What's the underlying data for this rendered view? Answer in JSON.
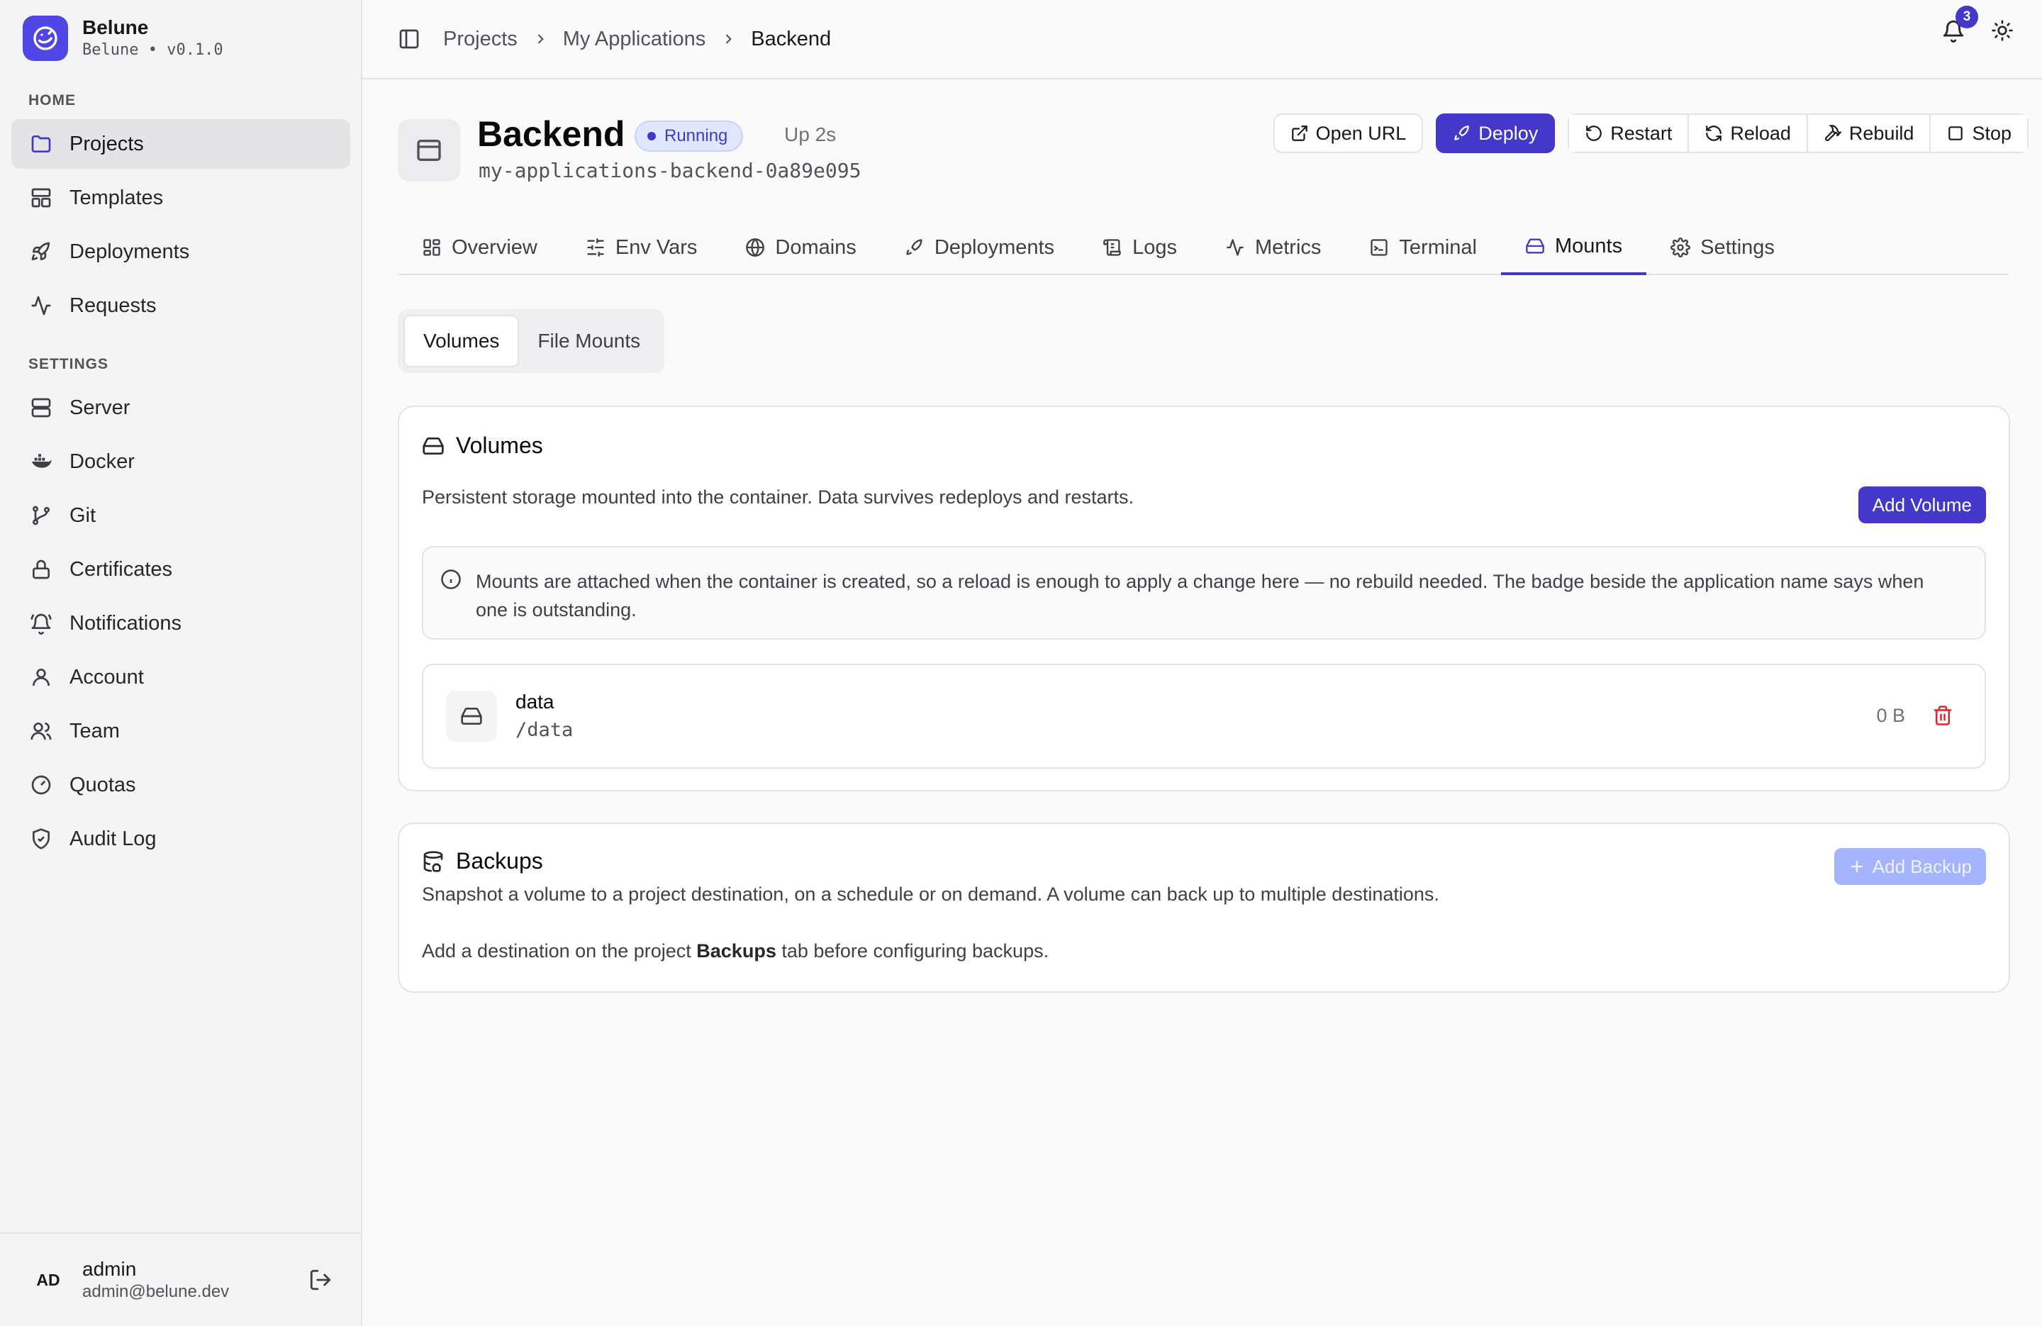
{
  "app": {
    "name": "Belune",
    "version": "Belune • v0.1.0"
  },
  "sidebar": {
    "home_label": "HOME",
    "home_items": [
      {
        "label": "Projects",
        "icon": "folder-icon",
        "active": true
      },
      {
        "label": "Templates",
        "icon": "layout-icon"
      },
      {
        "label": "Deployments",
        "icon": "rocket-icon"
      },
      {
        "label": "Requests",
        "icon": "activity-icon"
      }
    ],
    "settings_label": "SETTINGS",
    "settings_items": [
      {
        "label": "Server",
        "icon": "server-icon"
      },
      {
        "label": "Docker",
        "icon": "docker-icon"
      },
      {
        "label": "Git",
        "icon": "git-branch-icon"
      },
      {
        "label": "Certificates",
        "icon": "lock-icon"
      },
      {
        "label": "Notifications",
        "icon": "bell-ring-icon"
      },
      {
        "label": "Account",
        "icon": "user-icon"
      },
      {
        "label": "Team",
        "icon": "users-icon"
      },
      {
        "label": "Quotas",
        "icon": "gauge-icon"
      },
      {
        "label": "Audit Log",
        "icon": "shield-check-icon"
      }
    ],
    "user": {
      "initials": "AD",
      "name": "admin",
      "email": "admin@belune.dev"
    }
  },
  "breadcrumb": [
    "Projects",
    "My Applications",
    "Backend"
  ],
  "notifications_count": "3",
  "application": {
    "name": "Backend",
    "status": "Running",
    "uptime": "Up 2s",
    "slug": "my-applications-backend-0a89e095"
  },
  "actions": {
    "open_url": "Open URL",
    "deploy": "Deploy",
    "restart": "Restart",
    "reload": "Reload",
    "rebuild": "Rebuild",
    "stop": "Stop"
  },
  "tabs": [
    {
      "label": "Overview",
      "icon": "grid-icon"
    },
    {
      "label": "Env Vars",
      "icon": "sliders-icon"
    },
    {
      "label": "Domains",
      "icon": "globe-icon"
    },
    {
      "label": "Deployments",
      "icon": "rocket-icon"
    },
    {
      "label": "Logs",
      "icon": "scroll-icon"
    },
    {
      "label": "Metrics",
      "icon": "activity-icon"
    },
    {
      "label": "Terminal",
      "icon": "terminal-icon"
    },
    {
      "label": "Mounts",
      "icon": "hard-drive-icon",
      "active": true
    },
    {
      "label": "Settings",
      "icon": "gear-icon"
    }
  ],
  "subtabs": [
    {
      "label": "Volumes",
      "active": true
    },
    {
      "label": "File Mounts"
    }
  ],
  "volumes_card": {
    "title": "Volumes",
    "description": "Persistent storage mounted into the container. Data survives redeploys and restarts.",
    "add_button": "Add Volume",
    "info": "Mounts are attached when the container is created, so a reload is enough to apply a change here — no rebuild needed. The badge beside the application name says when one is outstanding.",
    "items": [
      {
        "name": "data",
        "path": "/data",
        "size": "0 B"
      }
    ]
  },
  "backups_card": {
    "title": "Backups",
    "description": "Snapshot a volume to a project destination, on a schedule or on demand. A volume can back up to multiple destinations.",
    "add_button": "Add Backup",
    "hint_before": "Add a destination on the project ",
    "hint_keyword": "Backups",
    "hint_after": " tab before configuring backups."
  },
  "colors": {
    "accent": "#4338ca",
    "danger": "#dc2626",
    "status_bg": "#e0e7ff"
  }
}
